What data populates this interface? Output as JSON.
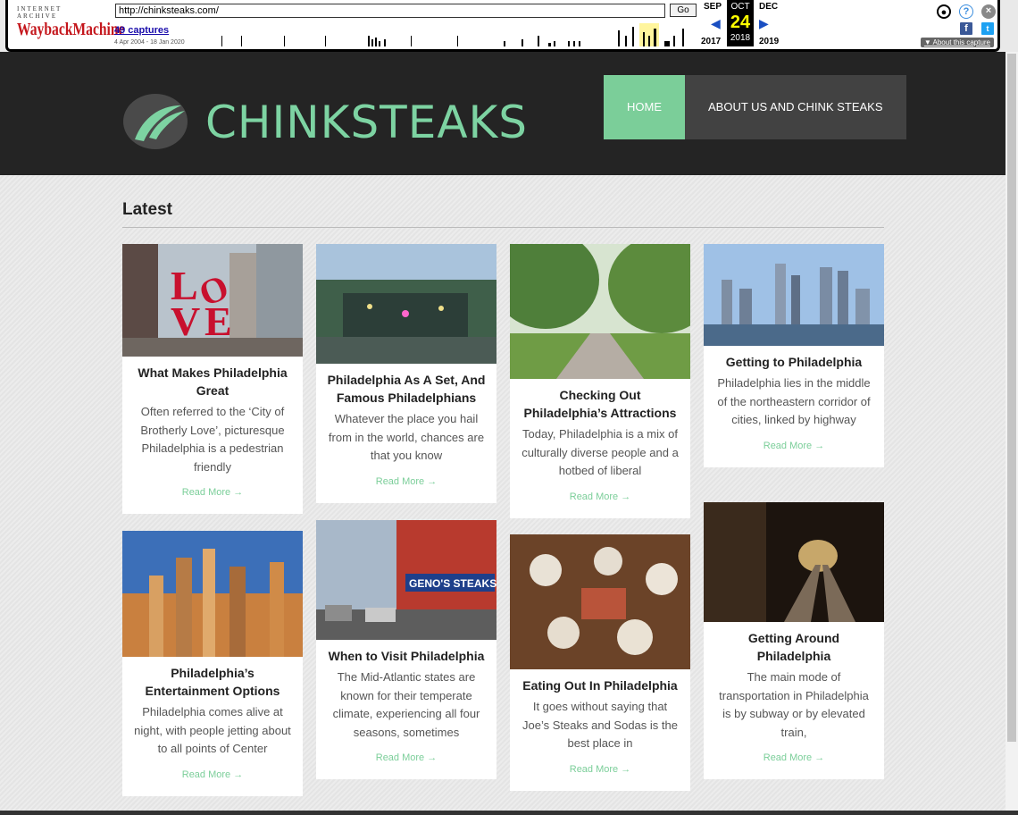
{
  "wayback": {
    "logo_top": "INTERNET ARCHIVE",
    "logo_main": "WaybackMachine",
    "url": "http://chinksteaks.com/",
    "go_label": "Go",
    "captures": "49 captures",
    "date_range": "4 Apr 2004 - 18 Jan 2020",
    "prev_month": "SEP",
    "current_month": "OCT",
    "next_month": "DEC",
    "day": "24",
    "prev_year": "2017",
    "current_year": "2018",
    "next_year": "2019",
    "about": "About this capture"
  },
  "site": {
    "title": "CHINKSTEAKS",
    "nav": [
      {
        "label": "HOME",
        "active": true
      },
      {
        "label": "ABOUT US AND CHINK STEAKS",
        "active": false
      }
    ],
    "accent": "#7bce99"
  },
  "latest_heading": "Latest",
  "read_more": "Read More →",
  "posts": [
    {
      "title": "What Makes Philadelphia Great",
      "excerpt": "Often referred to the ‘City of Brotherly Love’, picturesque Philadelphia is a pedestrian friendly",
      "image": "love-sculpture-photo"
    },
    {
      "title": "Philadelphia As A Set, And Famous Philadelphians",
      "excerpt": "Whatever the place you hail from in the world, chances are that you know",
      "image": "waterfront-garden-photo"
    },
    {
      "title": "Checking Out Philadelphia’s Attractions",
      "excerpt": "Today, Philadelphia is a mix of culturally diverse people and a hotbed of liberal",
      "image": "park-path-photo"
    },
    {
      "title": "Getting to Philadelphia",
      "excerpt": "Philadelphia lies in the middle of the northeastern corridor of cities, linked by highway",
      "image": "skyline-photo"
    },
    {
      "title": "Philadelphia’s Entertainment Options",
      "excerpt": "Philadelphia comes alive at night, with people jetting about to all points of Center",
      "image": "sunset-skyline-photo"
    },
    {
      "title": "When to Visit Philadelphia",
      "excerpt": "The Mid-Atlantic states are known for their temperate climate, experiencing all four seasons, sometimes",
      "image": "genos-steaks-photo"
    },
    {
      "title": "Eating Out In Philadelphia",
      "excerpt": "It goes without saying that Joe’s Steaks and Sodas is the best place in",
      "image": "dinner-table-photo"
    },
    {
      "title": "Getting Around Philadelphia",
      "excerpt": "The main mode of transportation in Philadelphia is by subway or by elevated train,",
      "image": "subway-tunnel-photo"
    }
  ]
}
